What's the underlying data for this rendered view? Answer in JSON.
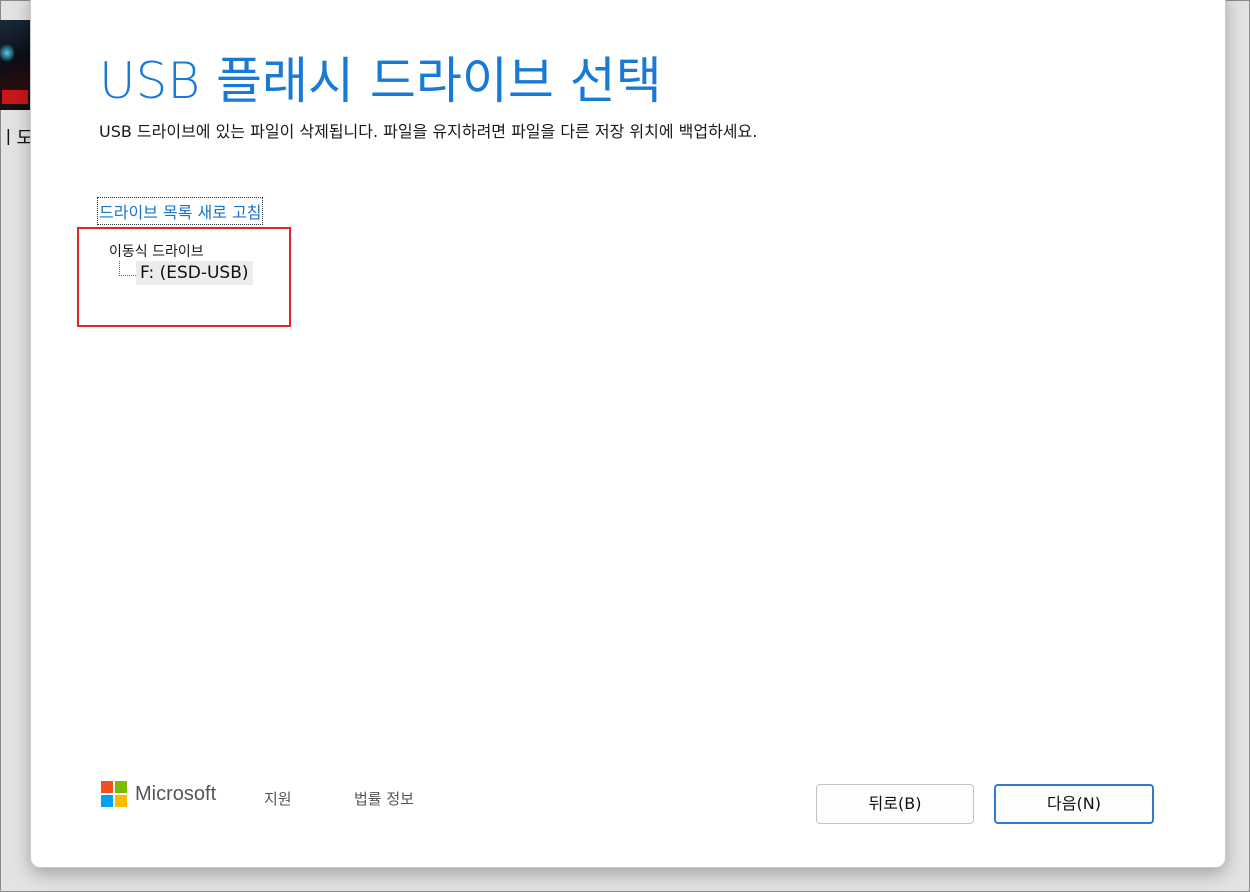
{
  "background": {
    "window_fragment_text": "ㅣ도-"
  },
  "dialog": {
    "title": "USB 플래시 드라이브 선택",
    "subtitle": "USB 드라이브에 있는 파일이 삭제됩니다. 파일을 유지하려면 파일을 다른 저장 위치에 백업하세요.",
    "refresh_link": "드라이브 목록 새로 고침",
    "drive_tree": {
      "group_label": "이동식 드라이브",
      "items": [
        {
          "label": "F: (ESD-USB)",
          "selected": true
        }
      ]
    }
  },
  "footer": {
    "brand": "Microsoft",
    "links": [
      "지원",
      "법률 정보"
    ],
    "logo_colors": [
      "#f25022",
      "#7fba00",
      "#00a4ef",
      "#ffb900"
    ]
  },
  "buttons": {
    "back": "뒤로(B)",
    "next": "다음(N)"
  },
  "colors": {
    "title": "#1979d6",
    "link": "#1a73c9",
    "highlight_box": "#e0262b",
    "primary_button_border": "#2f7bd0"
  }
}
